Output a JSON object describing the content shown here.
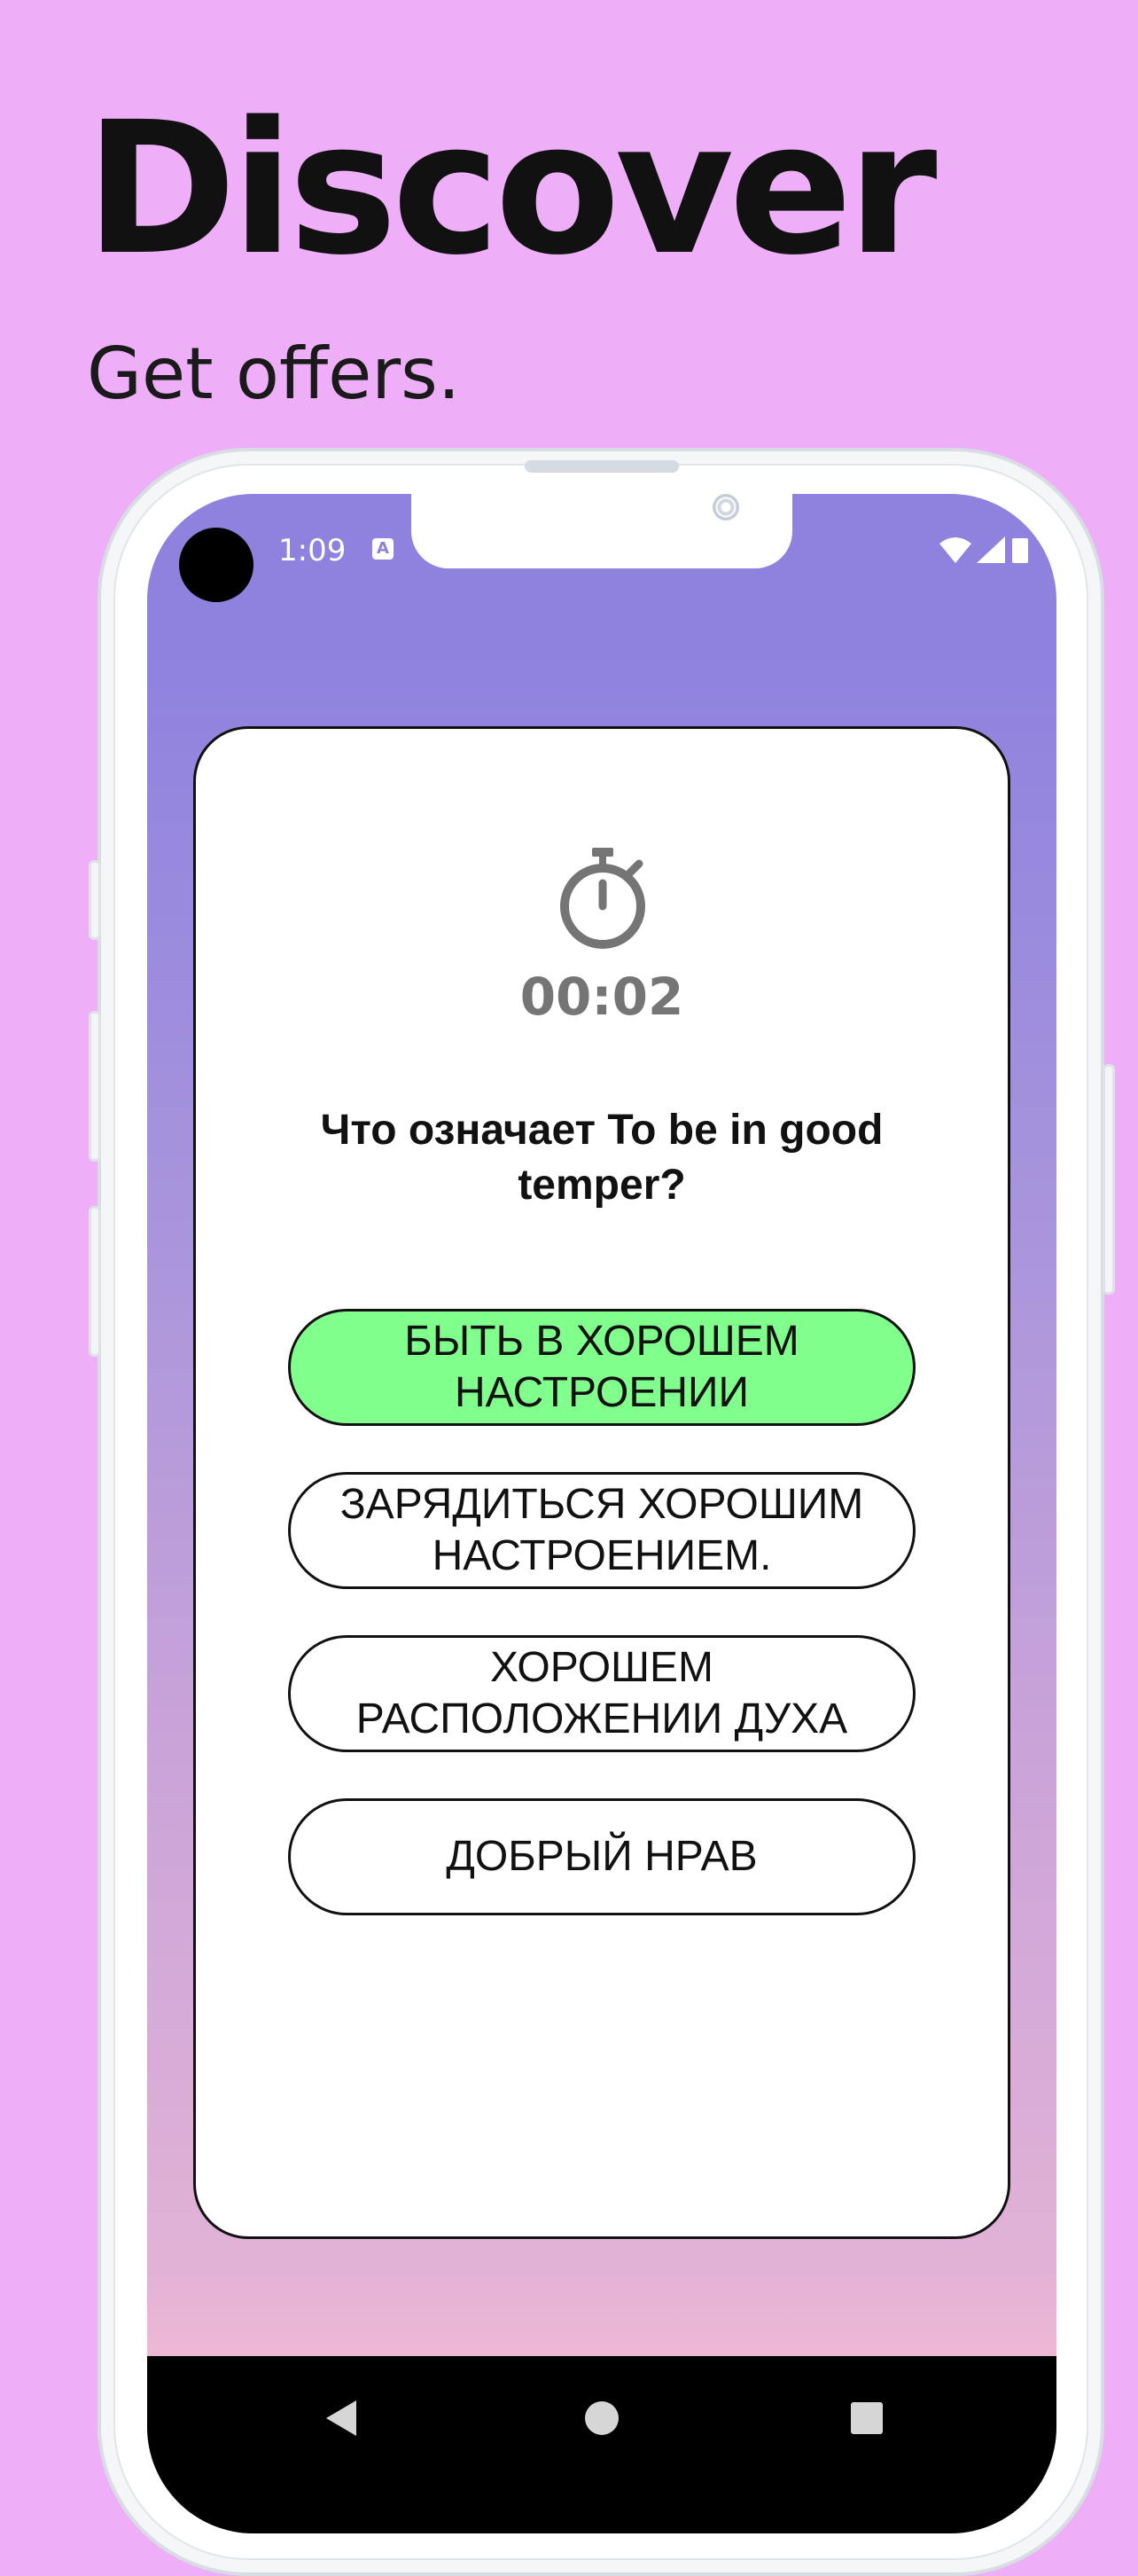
{
  "promo": {
    "headline": "Discover",
    "subheadline": "Get offers."
  },
  "status_bar": {
    "time": "1:09",
    "notification_icon": "A",
    "icons": [
      "wifi-icon",
      "cellular-signal-icon",
      "battery-icon"
    ]
  },
  "quiz": {
    "timer_icon": "stopwatch-icon",
    "timer": "00:02",
    "question": "Что означает To be in good temper?",
    "answers": [
      {
        "label": "БЫТЬ В ХОРОШЕМ НАСТРОЕНИИ",
        "state": "correct"
      },
      {
        "label": "ЗАРЯДИТЬСЯ ХОРОШИМ НАСТРОЕНИЕМ.",
        "state": "default"
      },
      {
        "label": "ХОРОШЕМ РАСПОЛОЖЕНИИ ДУХА",
        "state": "default"
      },
      {
        "label": "ДОБРЫЙ НРАВ",
        "state": "default"
      }
    ]
  },
  "navigation": {
    "buttons": [
      "back-icon",
      "home-icon",
      "recents-icon"
    ]
  },
  "colors": {
    "background": "#eeaef8",
    "screen_gradient_top": "#8f82df",
    "screen_gradient_bottom": "#eeb8d5",
    "correct_answer": "#80ff8c",
    "timer_gray": "#757575"
  }
}
